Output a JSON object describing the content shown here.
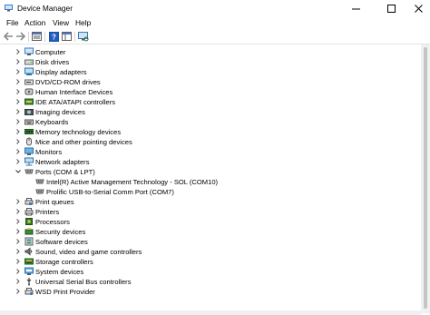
{
  "window": {
    "title": "Device Manager"
  },
  "menu": [
    "File",
    "Action",
    "View",
    "Help"
  ],
  "toolbar": [
    "back-icon",
    "forward-icon",
    "properties-icon",
    "help-icon",
    "show-hide-icon",
    "scan-icon"
  ],
  "tree": [
    {
      "label": "Computer",
      "icon": "computer-icon",
      "expanded": false
    },
    {
      "label": "Disk drives",
      "icon": "disk-drive-icon",
      "expanded": false
    },
    {
      "label": "Display adapters",
      "icon": "display-adapter-icon",
      "expanded": false
    },
    {
      "label": "DVD/CD-ROM drives",
      "icon": "dvd-drive-icon",
      "expanded": false
    },
    {
      "label": "Human Interface Devices",
      "icon": "hid-icon",
      "expanded": false
    },
    {
      "label": "IDE ATA/ATAPI controllers",
      "icon": "ide-controller-icon",
      "expanded": false
    },
    {
      "label": "Imaging devices",
      "icon": "camera-icon",
      "expanded": false
    },
    {
      "label": "Keyboards",
      "icon": "keyboard-icon",
      "expanded": false
    },
    {
      "label": "Memory technology devices",
      "icon": "memory-icon",
      "expanded": false
    },
    {
      "label": "Mice and other pointing devices",
      "icon": "mouse-icon",
      "expanded": false
    },
    {
      "label": "Monitors",
      "icon": "monitor-icon",
      "expanded": false
    },
    {
      "label": "Network adapters",
      "icon": "network-icon",
      "expanded": false
    },
    {
      "label": "Ports (COM & LPT)",
      "icon": "port-icon",
      "expanded": true,
      "children": [
        {
          "label": "Intel(R) Active Management Technology - SOL (COM10)",
          "icon": "port-icon"
        },
        {
          "label": "Prolific USB-to-Serial Comm Port (COM7)",
          "icon": "port-icon"
        }
      ]
    },
    {
      "label": "Print queues",
      "icon": "print-queue-icon",
      "expanded": false
    },
    {
      "label": "Printers",
      "icon": "printer-icon",
      "expanded": false
    },
    {
      "label": "Processors",
      "icon": "processor-icon",
      "expanded": false
    },
    {
      "label": "Security devices",
      "icon": "security-icon",
      "expanded": false
    },
    {
      "label": "Software devices",
      "icon": "software-icon",
      "expanded": false
    },
    {
      "label": "Sound, video and game controllers",
      "icon": "sound-icon",
      "expanded": false
    },
    {
      "label": "Storage controllers",
      "icon": "storage-icon",
      "expanded": false
    },
    {
      "label": "System devices",
      "icon": "system-icon",
      "expanded": false
    },
    {
      "label": "Universal Serial Bus controllers",
      "icon": "usb-icon",
      "expanded": false
    },
    {
      "label": "WSD Print Provider",
      "icon": "wsd-icon",
      "expanded": false
    }
  ]
}
